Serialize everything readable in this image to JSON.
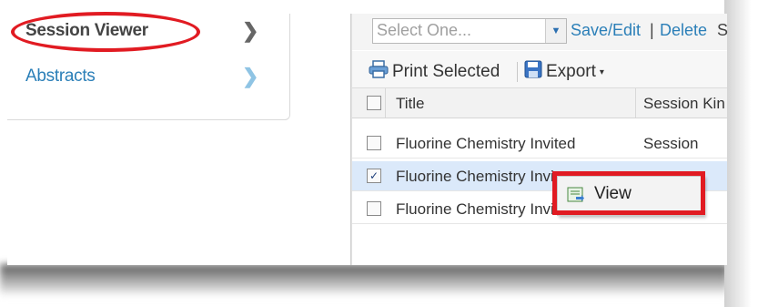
{
  "sidebar": {
    "items": [
      {
        "label": "Session Viewer",
        "icon": "chevron-right-icon"
      },
      {
        "label": "Abstracts",
        "icon": "chevron-right-icon"
      }
    ]
  },
  "toolbar": {
    "select_value": "Select One...",
    "save_edit_label": "Save/Edit",
    "pipe": "|",
    "delete_label": "Delete",
    "trailing_text": "S",
    "print_label": "Print Selected",
    "export_label": "Export"
  },
  "grid": {
    "columns": [
      "Title",
      "Session Kin"
    ],
    "rows": [
      {
        "title": "Fluorine Chemistry Invited",
        "kind": "Session",
        "checked": false
      },
      {
        "title": "Fluorine Chemistry Invit",
        "kind": "",
        "checked": true
      },
      {
        "title": "Fluorine Chemistry Invit",
        "kind": "",
        "checked": false
      }
    ]
  },
  "context_menu": {
    "items": [
      {
        "label": "View",
        "icon": "view-icon"
      }
    ]
  },
  "colors": {
    "link": "#2b7fb8",
    "highlight": "#e11b22",
    "selected_row": "#dbe9fa"
  }
}
